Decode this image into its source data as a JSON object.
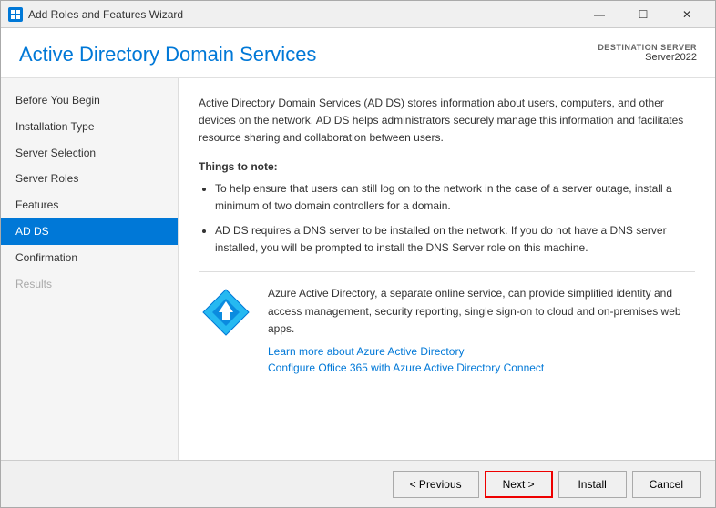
{
  "window": {
    "title": "Add Roles and Features Wizard",
    "controls": {
      "minimize": "—",
      "maximize": "☐",
      "close": "✕"
    }
  },
  "header": {
    "title": "Active Directory Domain Services",
    "destination_label": "DESTINATION SERVER",
    "destination_value": "Server2022"
  },
  "sidebar": {
    "items": [
      {
        "id": "before-you-begin",
        "label": "Before You Begin",
        "state": "normal"
      },
      {
        "id": "installation-type",
        "label": "Installation Type",
        "state": "normal"
      },
      {
        "id": "server-selection",
        "label": "Server Selection",
        "state": "normal"
      },
      {
        "id": "server-roles",
        "label": "Server Roles",
        "state": "normal"
      },
      {
        "id": "features",
        "label": "Features",
        "state": "normal"
      },
      {
        "id": "ad-ds",
        "label": "AD DS",
        "state": "active"
      },
      {
        "id": "confirmation",
        "label": "Confirmation",
        "state": "normal"
      },
      {
        "id": "results",
        "label": "Results",
        "state": "disabled"
      }
    ]
  },
  "main": {
    "description": "Active Directory Domain Services (AD DS) stores information about users, computers, and other devices on the network. AD DS helps administrators securely manage this information and facilitates resource sharing and collaboration between users.",
    "things_to_note": "Things to note:",
    "bullets": [
      "To help ensure that users can still log on to the network in the case of a server outage, install a minimum of two domain controllers for a domain.",
      "AD DS requires a DNS server to be installed on the network. If you do not have a DNS server installed, you will be prompted to install the DNS Server role on this machine."
    ],
    "azure": {
      "text": "Azure Active Directory, a separate online service, can provide simplified identity and access management, security reporting, single sign-on to cloud and on-premises web apps.",
      "link1": "Learn more about Azure Active Directory",
      "link2": "Configure Office 365 with Azure Active Directory Connect"
    }
  },
  "footer": {
    "previous_label": "< Previous",
    "next_label": "Next >",
    "install_label": "Install",
    "cancel_label": "Cancel"
  }
}
